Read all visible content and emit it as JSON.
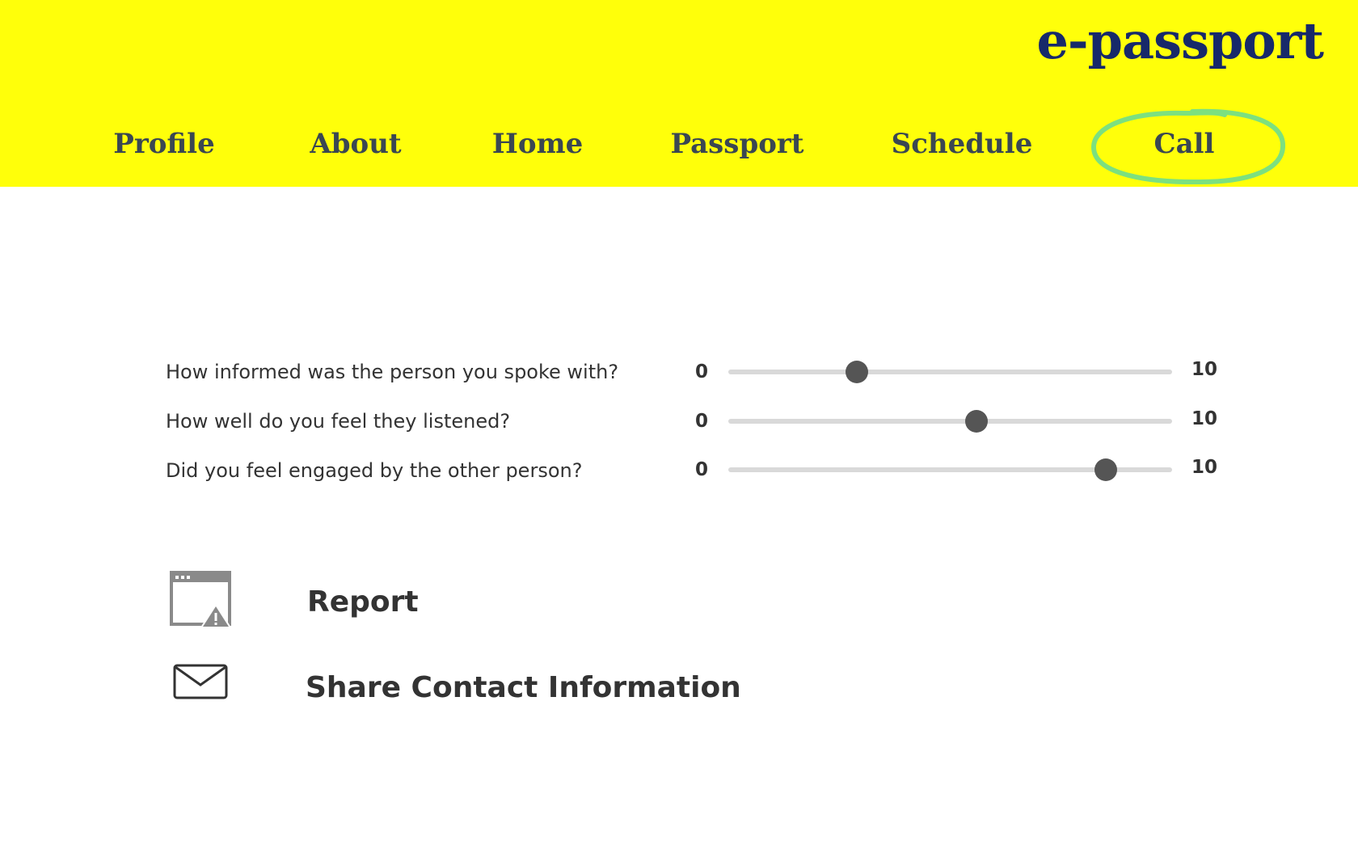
{
  "header": {
    "brand": "e-passport",
    "background": "#ffff0a",
    "brand_color": "#17296a",
    "highlight_color": "#7ce07f",
    "nav": [
      {
        "label": "Profile"
      },
      {
        "label": "About"
      },
      {
        "label": "Home"
      },
      {
        "label": "Passport"
      },
      {
        "label": "Schedule"
      },
      {
        "label": "Call",
        "highlighted": true
      }
    ]
  },
  "ratings": [
    {
      "question": "How informed was the person you spoke with?",
      "min": "0",
      "max": "10",
      "value": 2.9
    },
    {
      "question": "How well do you feel they listened?",
      "min": "0",
      "max": "10",
      "value": 5.6
    },
    {
      "question": "Did you feel engaged by the other person?",
      "min": "0",
      "max": "10",
      "value": 8.5
    }
  ],
  "actions": {
    "report": {
      "label": "Report",
      "icon": "window-warning-icon"
    },
    "share": {
      "label": "Share Contact Information",
      "icon": "envelope-icon"
    }
  }
}
